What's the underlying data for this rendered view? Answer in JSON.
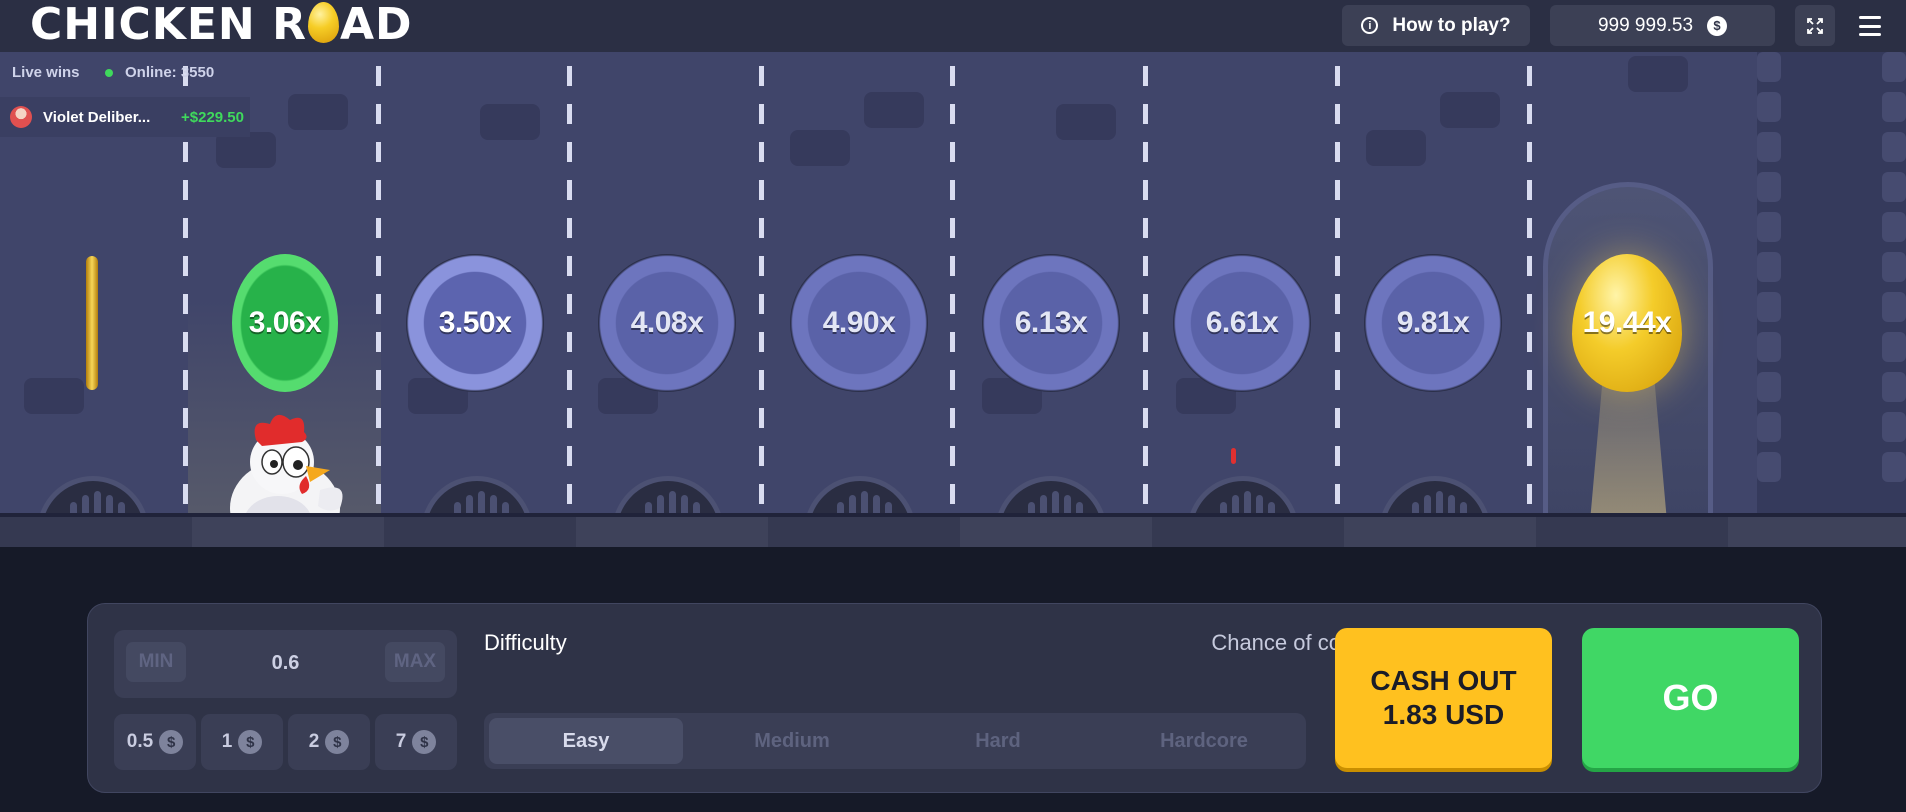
{
  "header": {
    "logo_left": "CHICKEN R",
    "logo_right": "AD",
    "how_to_play": "How to play?",
    "balance": "999 999.53",
    "currency_symbol": "$"
  },
  "live": {
    "label": "Live wins",
    "online": "Online: 3550",
    "wins": [
      {
        "name": "Violet Deliber...",
        "amount": "+$229.50"
      }
    ]
  },
  "lanes": {
    "multipliers": [
      "3.06x",
      "3.50x",
      "4.08x",
      "4.90x",
      "6.13x",
      "6.61x",
      "9.81x",
      "19.44x"
    ],
    "current_index": 0,
    "next_index": 1,
    "final_reward": "golden-egg"
  },
  "controls": {
    "bet": {
      "min_label": "MIN",
      "max_label": "MAX",
      "value": "0.6"
    },
    "quick_bets": [
      {
        "value": "0.5",
        "icon": "$"
      },
      {
        "value": "1",
        "icon": "$"
      },
      {
        "value": "2",
        "icon": "$"
      },
      {
        "value": "7",
        "icon": "$"
      }
    ],
    "difficulty_label": "Difficulty",
    "collision_label": "Chance of collision",
    "difficulties": [
      "Easy",
      "Medium",
      "Hard",
      "Hardcore"
    ],
    "selected_difficulty": "Easy",
    "cash_out_line1": "CASH OUT",
    "cash_out_line2": "1.83 USD",
    "go_label": "GO"
  },
  "colors": {
    "accent_green": "#40d765",
    "cash_out_yellow": "#ffc11f",
    "scene_bg": "#40456a",
    "page_bg": "#161a28"
  }
}
